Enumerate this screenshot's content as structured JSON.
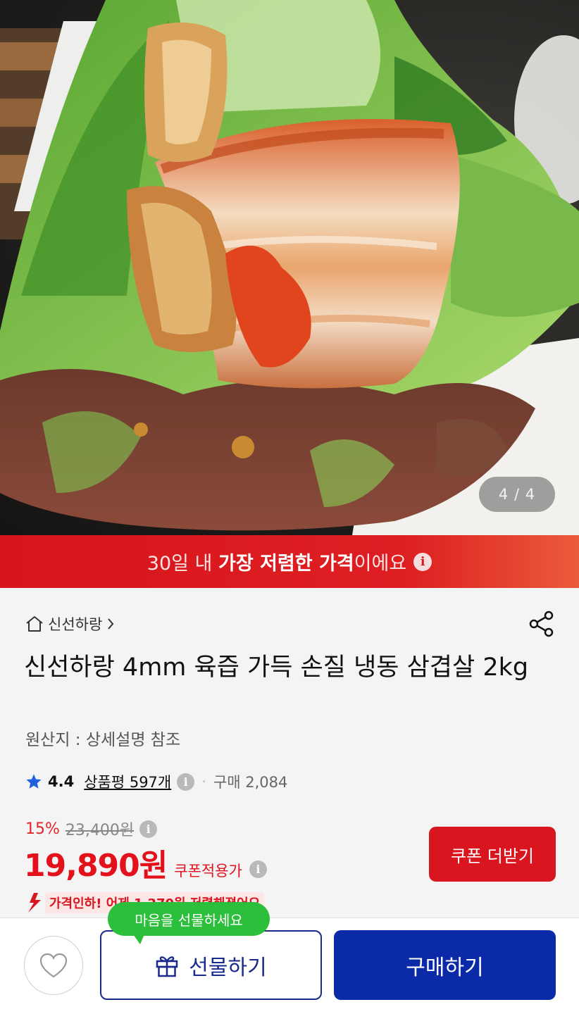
{
  "gallery": {
    "counter": "4 / 4"
  },
  "banner": {
    "prefix": "30일 내 ",
    "highlight": "가장 저렴한 가격",
    "suffix": "이에요"
  },
  "product": {
    "store_name": "신선하랑",
    "title": "신선하랑 4mm 육즙 가득 손질 냉동 삼겹살 2kg",
    "origin": "원산지 : 상세설명 참조",
    "rating": "4.4",
    "reviews_label": "상품평 597개",
    "purchase_count": "구매 2,084",
    "discount_percent": "15%",
    "original_price": "23,400원",
    "price": "19,890원",
    "price_note": "쿠폰적용가",
    "coupon_button": "쿠폰 더받기",
    "price_drop_text": "가격인하! 어제 1,270원 저렴해졌어요"
  },
  "bottom_bar": {
    "tooltip": "마음을 선물하세요",
    "gift_button": "선물하기",
    "buy_button": "구매하기"
  },
  "colors": {
    "accent_red": "#e3111b",
    "buy_blue": "#0b2aa8",
    "tooltip_green": "#2cbf3b"
  }
}
